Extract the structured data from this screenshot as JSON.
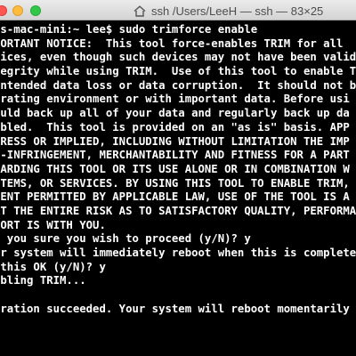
{
  "window": {
    "title": "ssh  /Users/LeeH — ssh — 83×25",
    "background": "#000000",
    "foreground": "#ffffff"
  },
  "terminal": {
    "lines": [
      "es-mac-mini:~ lee$ sudo trimforce enable",
      "PORTANT NOTICE:  This tool force-enables TRIM for all",
      "vices, even though such devices may not have been valid",
      "tegrity while using TRIM.  Use of this tool to enable T",
      "intended data loss or data corruption.  It should not b",
      "erating environment or with important data. Before usi",
      "ould back up all of your data and regularly back up da",
      "abled.  This tool is provided on an \"as is\" basis. APP",
      "PRESS OR IMPLIED, INCLUDING WITHOUT LIMITATION THE IMP",
      "N-INFRINGEMENT, MERCHANTABILITY AND FITNESS FOR A PART",
      "GARDING THIS TOOL OR ITS USE ALONE OR IN COMBINATION W",
      "STEMS, OR SERVICES. BY USING THIS TOOL TO ENABLE TRIM,",
      "TENT PERMITTED BY APPLICABLE LAW, USE OF THE TOOL IS A",
      "AT THE ENTIRE RISK AS TO SATISFACTORY QUALITY, PERFORMA",
      "FORT IS WITH YOU.",
      "e you sure you wish to proceed (y/N)? y",
      "ur system will immediately reboot when this is complete",
      " this OK (y/N)? y",
      "abling TRIM...",
      "",
      "eration succeeded. Your system will reboot momentarily"
    ]
  }
}
